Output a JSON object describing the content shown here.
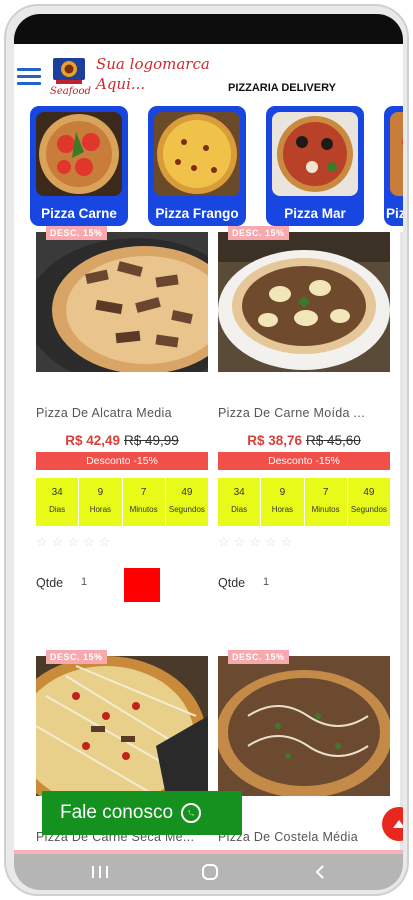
{
  "header": {
    "logo_script": "Seafood",
    "logo_text_line1": "Sua logomarca",
    "logo_text_line2": "Aqui...",
    "title": "PIZZARIA DELIVERY"
  },
  "categories": [
    {
      "label": "Pizza Carne"
    },
    {
      "label": "Pizza Frango"
    },
    {
      "label": "Pizza Mar"
    },
    {
      "label": "Pizz"
    }
  ],
  "products": [
    {
      "badge": "DESC. 15%",
      "name": "Pizza De Alcatra Media",
      "price_new": "R$ 42,49",
      "price_old": "R$ 49,99",
      "discount": "Desconto -15%",
      "countdown": [
        {
          "value": "34",
          "unit": "Dias"
        },
        {
          "value": "9",
          "unit": "Horas"
        },
        {
          "value": "7",
          "unit": "Minutos"
        },
        {
          "value": "49",
          "unit": "Segundos"
        }
      ],
      "stars": "☆☆☆☆☆",
      "qty_label": "Qtde",
      "qty_value": "1"
    },
    {
      "badge": "DESC. 15%",
      "name": "Pizza De Carne Moída ...",
      "price_new": "R$ 38,76",
      "price_old": "R$ 45,60",
      "discount": "Desconto -15%",
      "countdown": [
        {
          "value": "34",
          "unit": "Dias"
        },
        {
          "value": "9",
          "unit": "Horas"
        },
        {
          "value": "7",
          "unit": "Minutos"
        },
        {
          "value": "49",
          "unit": "Segundos"
        }
      ],
      "stars": "☆☆☆☆☆",
      "qty_label": "Qtde",
      "qty_value": "1"
    },
    {
      "badge": "DESC. 15%",
      "name": "Pizza De Carne Seca Mé..."
    },
    {
      "badge": "DESC. 15%",
      "name": "Pizza De Costela Média"
    }
  ],
  "contact_button": {
    "label": "Fale conosco",
    "icon": "whatsapp-icon"
  },
  "back_to_top": {
    "icon": "arrow-up-icon"
  },
  "colors": {
    "category_bg": "#1846e0",
    "countdown_bg": "#e8fb18",
    "discount_bg": "#f14f4a",
    "contact_bg": "#14911e",
    "price_new": "#d6413a"
  }
}
